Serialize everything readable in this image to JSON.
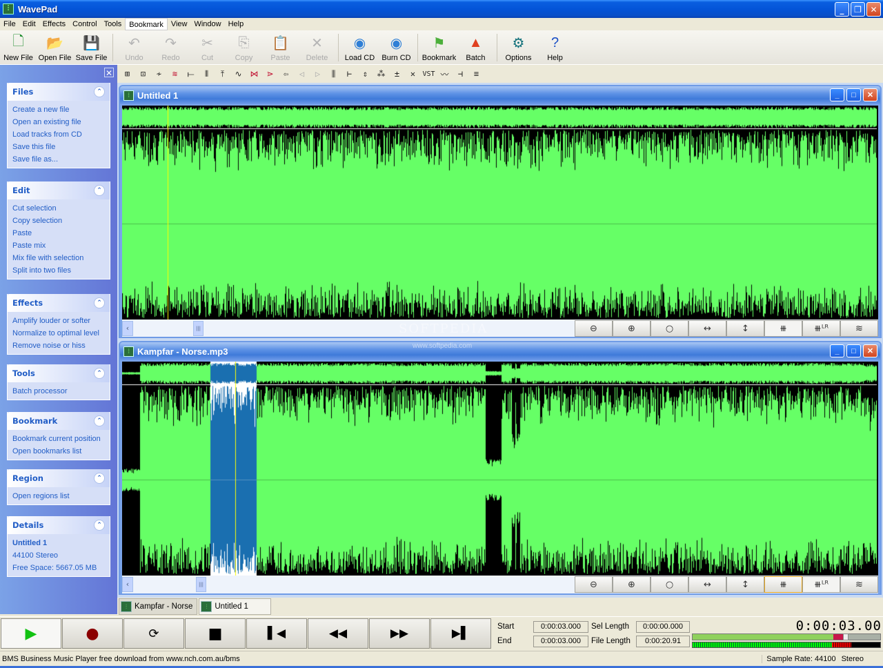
{
  "window": {
    "title": "WavePad",
    "app_icon": "waveform-icon"
  },
  "menu": [
    "File",
    "Edit",
    "Effects",
    "Control",
    "Tools",
    "Bookmark",
    "View",
    "Window",
    "Help"
  ],
  "menu_highlighted": "Bookmark",
  "toolbar": [
    {
      "label": "New File",
      "icon": "new-file-icon",
      "enabled": true
    },
    {
      "label": "Open File",
      "icon": "open-folder-icon",
      "enabled": true
    },
    {
      "label": "Save File",
      "icon": "floppy-disk-icon",
      "enabled": true
    },
    {
      "label": "Undo",
      "icon": "undo-icon",
      "enabled": false
    },
    {
      "label": "Redo",
      "icon": "redo-icon",
      "enabled": false
    },
    {
      "label": "Cut",
      "icon": "scissors-icon",
      "enabled": false
    },
    {
      "label": "Copy",
      "icon": "copy-icon",
      "enabled": false
    },
    {
      "label": "Paste",
      "icon": "paste-icon",
      "enabled": false
    },
    {
      "label": "Delete",
      "icon": "delete-x-icon",
      "enabled": false
    },
    {
      "label": "Load CD",
      "icon": "load-cd-icon",
      "enabled": true
    },
    {
      "label": "Burn CD",
      "icon": "burn-cd-icon",
      "enabled": true
    },
    {
      "label": "Bookmark",
      "icon": "bookmark-icon",
      "enabled": true
    },
    {
      "label": "Batch",
      "icon": "batch-icon",
      "enabled": true
    },
    {
      "label": "Options",
      "icon": "gear-icon",
      "enabled": true
    },
    {
      "label": "Help",
      "icon": "help-icon",
      "enabled": true
    }
  ],
  "effects_toolbar": [
    "normalize",
    "reduce-noise",
    "amplify",
    "echo",
    "silence",
    "tremolo",
    "envelope",
    "pitch",
    "reverse-region",
    "fade-in-cut",
    "back-arrow",
    "fade-in",
    "fade-out",
    "equalizer",
    "insert-silence",
    "stretch",
    "noise-gate",
    "invert",
    "clear",
    "VST",
    "distortion",
    "speed",
    "compressor"
  ],
  "sidebar": {
    "panels": [
      {
        "title": "Files",
        "items": [
          "Create a new file",
          "Open an existing file",
          "Load tracks from CD",
          "Save this file",
          "Save file as..."
        ]
      },
      {
        "title": "Edit",
        "items": [
          "Cut selection",
          "Copy selection",
          "Paste",
          "Paste mix",
          "Mix file with selection",
          "Split into two files"
        ]
      },
      {
        "title": "Effects",
        "items": [
          "Amplify louder or softer",
          "Normalize to optimal level",
          "Remove noise or hiss"
        ]
      },
      {
        "title": "Tools",
        "items": [
          "Batch processor"
        ]
      },
      {
        "title": "Bookmark",
        "items": [
          "Bookmark current position",
          "Open bookmarks list"
        ]
      },
      {
        "title": "Region",
        "items": [
          "Open regions list"
        ]
      },
      {
        "title": "Details",
        "items": [
          "Untitled 1",
          "44100 Stereo",
          "Free Space: 5667.05 MB"
        ]
      }
    ]
  },
  "documents": [
    {
      "title": "Untitled 1",
      "cursor_fraction": 0.06
    },
    {
      "title": "Kampfar - Norse.mp3",
      "selection_fraction": [
        0.117,
        0.178
      ],
      "cursor_fraction": 0.15
    }
  ],
  "zoom_buttons": [
    "zoom-out-icon",
    "zoom-in-icon",
    "zoom-full-icon",
    "zoom-horizontal-icon",
    "zoom-vertical-icon",
    "amplitude-view-icon",
    "left-right-view-icon",
    "split-channels-icon"
  ],
  "doc_tabs": [
    "Kampfar - Norse",
    "Untitled 1"
  ],
  "transport": {
    "buttons": [
      "play-icon",
      "record-icon",
      "loop-icon",
      "stop-icon",
      "go-start-icon",
      "rewind-icon",
      "fast-forward-icon",
      "go-end-icon"
    ],
    "start_label": "Start",
    "start_value": "0:00:03.000",
    "end_label": "End",
    "end_value": "0:00:03.000",
    "sel_length_label": "Sel Length",
    "sel_length_value": "0:00:00.000",
    "file_length_label": "File Length",
    "file_length_value": "0:00:20.91",
    "current_time": "0:00:03.00",
    "volume_fraction": 0.8
  },
  "status": {
    "left": "BMS Business Music Player free download from www.nch.com.au/bms",
    "sample_rate": "Sample Rate: 44100",
    "channels": "Stereo"
  },
  "watermark": {
    "brand": "SOFTPEDIA",
    "url": "www.softpedia.com"
  },
  "colors": {
    "wave": "#66ff66",
    "wave_sel": "#1a6fb0",
    "cursor": "#ffff00",
    "title_blue": "#0454d8",
    "link_blue": "#215dc6"
  }
}
